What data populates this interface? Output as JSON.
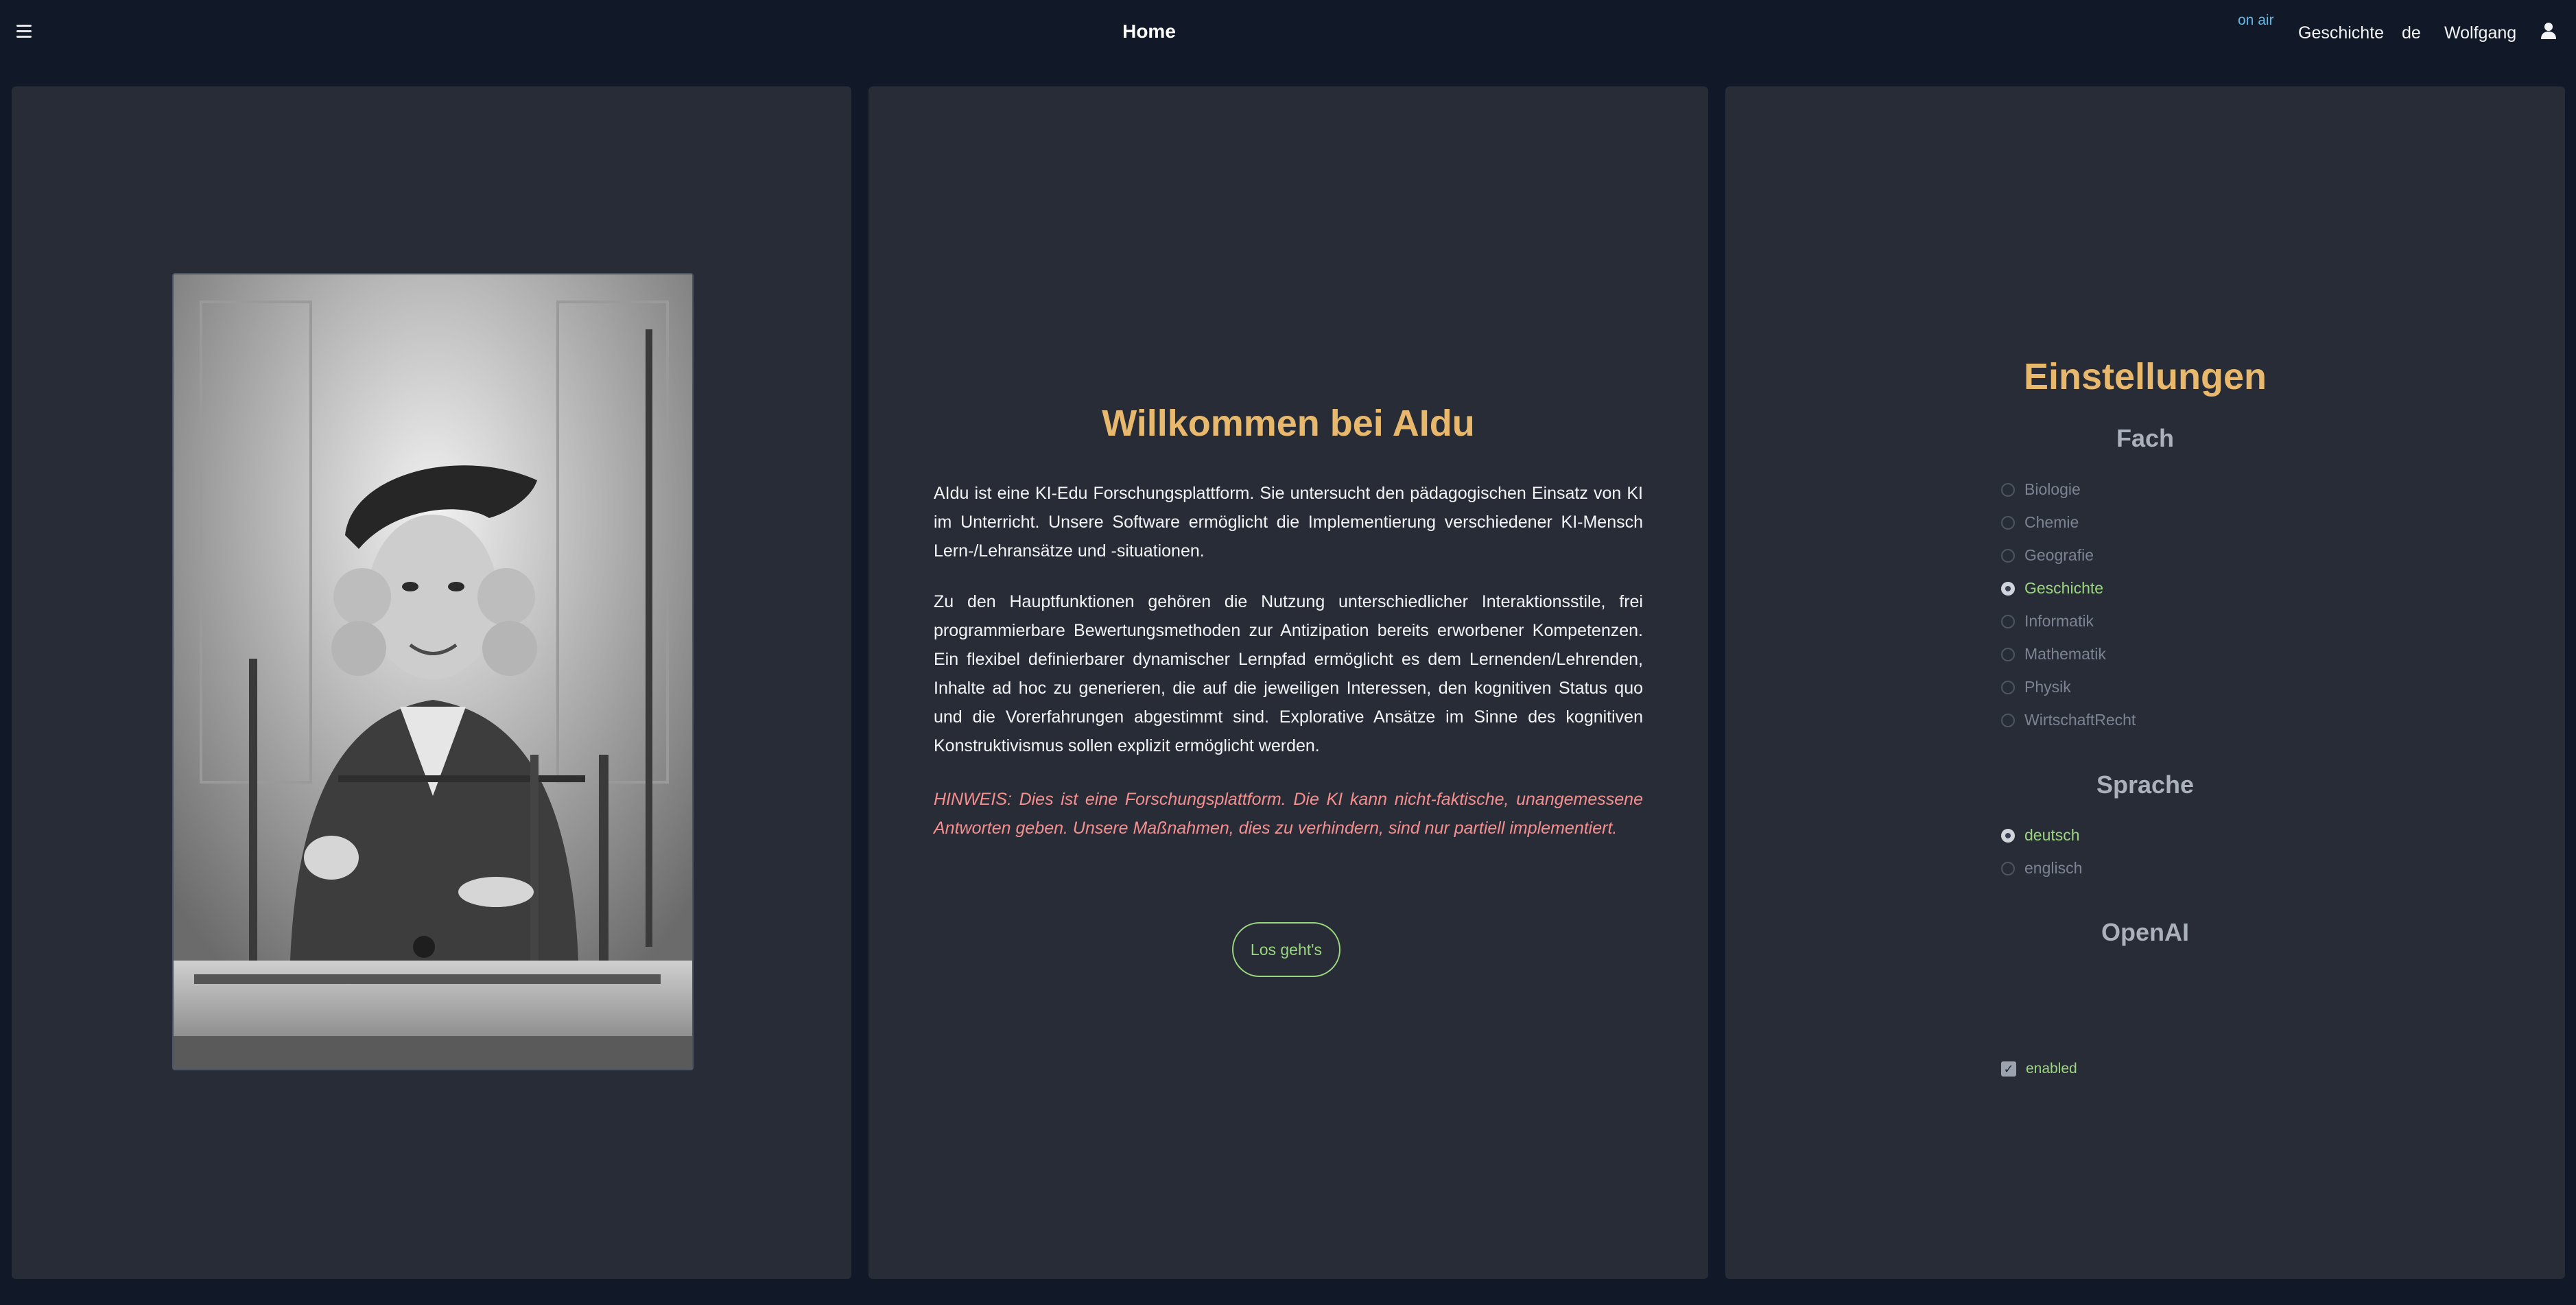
{
  "header": {
    "title": "Home",
    "status": "on air",
    "subject": "Geschichte",
    "language": "de",
    "user": "Wolfgang",
    "icons": {
      "menu": "hamburger-icon",
      "user": "user-icon"
    }
  },
  "welcome": {
    "heading": "Willkommen bei AIdu",
    "intro": "AIdu ist eine KI-Edu Forschungsplattform. Sie untersucht den pädagogischen Einsatz von KI im Unterricht. Unsere Software ermöglicht die Implementierung verschiedener KI-Mensch Lern-/Lehransätze und -situationen.",
    "features": "Zu den Hauptfunktionen gehören die Nutzung unterschiedlicher Interaktionsstile, frei programmierbare Bewertungsmethoden zur Antizipation bereits erworbener Kompetenzen. Ein flexibel definierbarer dynamischer Lernpfad ermöglicht es dem Lernenden/Lehrenden, Inhalte ad hoc zu generieren, die auf die jeweiligen Interessen, den kognitiven Status quo und die Vorerfahrungen abgestimmt sind. Explorative Ansätze im Sinne des kognitiven Konstruktivismus sollen explizit ermöglicht werden.",
    "notice": "HINWEIS: Dies ist eine Forschungsplattform. Die KI kann nicht-faktische, unangemessene Antworten geben. Unsere Maßnahmen, dies zu verhindern, sind nur partiell implementiert.",
    "button": "Los geht's"
  },
  "settings": {
    "title": "Einstellungen",
    "subject_heading": "Fach",
    "subjects": [
      {
        "label": "Biologie",
        "checked": false
      },
      {
        "label": "Chemie",
        "checked": false
      },
      {
        "label": "Geografie",
        "checked": false
      },
      {
        "label": "Geschichte",
        "checked": true
      },
      {
        "label": "Informatik",
        "checked": false
      },
      {
        "label": "Mathematik",
        "checked": false
      },
      {
        "label": "Physik",
        "checked": false
      },
      {
        "label": "WirtschaftRecht",
        "checked": false
      }
    ],
    "language_heading": "Sprache",
    "languages": [
      {
        "label": "deutsch",
        "checked": true
      },
      {
        "label": "englisch",
        "checked": false
      }
    ],
    "openai_heading": "OpenAI",
    "openai_enabled_label": "enabled",
    "openai_enabled": true
  },
  "colors": {
    "background": "#111827",
    "panel": "#282c37",
    "accent_heading": "#e8b86d",
    "accent_green": "#9bd67f",
    "notice_red": "#f58f8f",
    "status_blue": "#5fb8ea"
  }
}
